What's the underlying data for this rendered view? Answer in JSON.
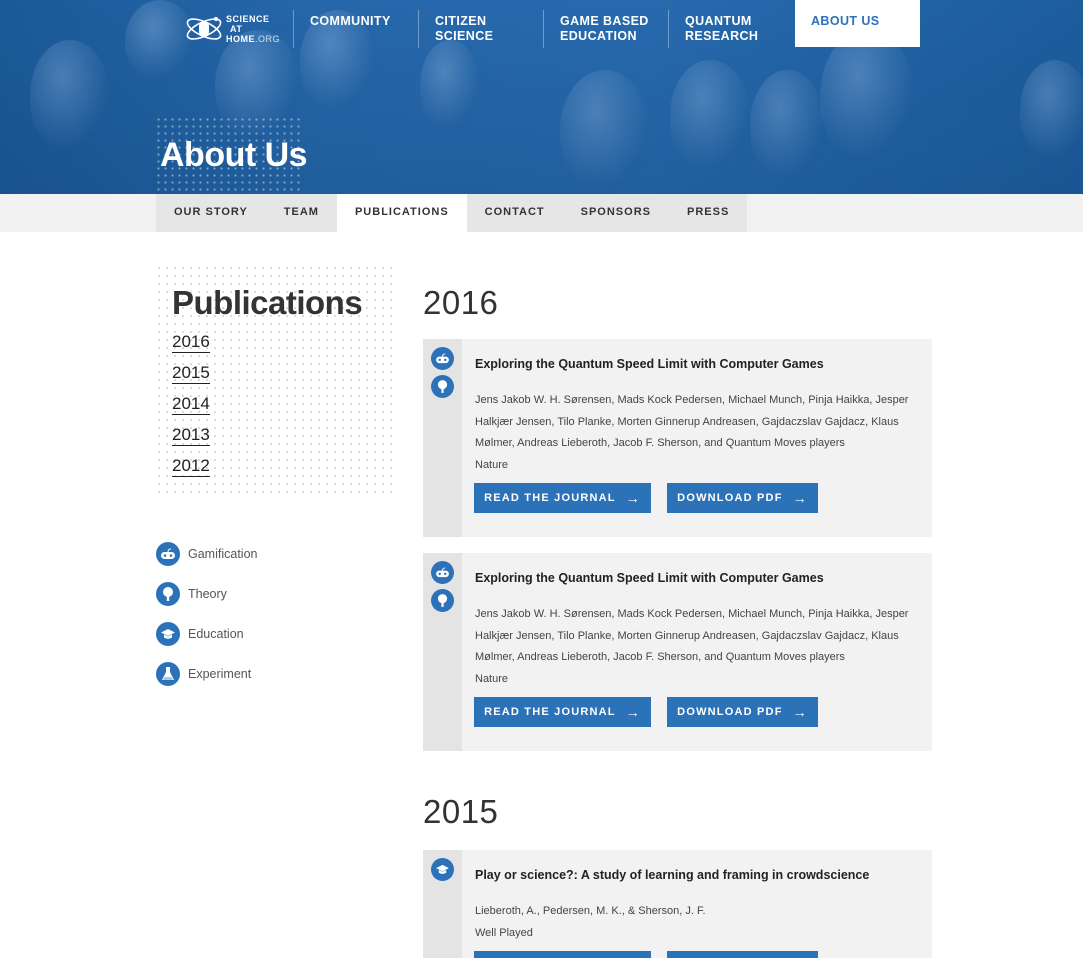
{
  "logo": {
    "line1": "SCIENCE",
    "line2": "AT",
    "line3": "HOME",
    "line3_suffix": ".ORG"
  },
  "nav": {
    "items": [
      {
        "label": "COMMUNITY"
      },
      {
        "label": "CITIZEN\nSCIENCE"
      },
      {
        "label": "GAME BASED\nEDUCATION"
      },
      {
        "label": "QUANTUM\nRESEARCH"
      }
    ],
    "active_label": "ABOUT US"
  },
  "hero": {
    "title": "About Us"
  },
  "subnav": {
    "items": [
      "OUR STORY",
      "TEAM",
      "PUBLICATIONS",
      "CONTACT",
      "SPONSORS",
      "PRESS"
    ],
    "active": "PUBLICATIONS"
  },
  "sidebar": {
    "title": "Publications",
    "years": [
      "2016",
      "2015",
      "2014",
      "2013",
      "2012"
    ],
    "legend": [
      {
        "label": "Gamification",
        "icon": "gamepad-icon"
      },
      {
        "label": "Theory",
        "icon": "lightbulb-icon"
      },
      {
        "label": "Education",
        "icon": "graduation-cap-icon"
      },
      {
        "label": "Experiment",
        "icon": "flask-icon"
      }
    ]
  },
  "sections": [
    {
      "year": "2016",
      "cards": [
        {
          "title": "Exploring the Quantum Speed Limit with Computer Games",
          "authors": "Jens Jakob W. H. Sørensen, Mads Kock Pedersen, Michael Munch, Pinja Haikka, Jesper Halkjær Jensen, Tilo Planke, Morten Ginnerup Andreasen, Gajdaczslav Gajdacz, Klaus Mølmer, Andreas Lieberoth, Jacob F. Sherson, and Quantum Moves players",
          "journal": "Nature",
          "icons": [
            "gamepad-icon",
            "lightbulb-icon"
          ]
        },
        {
          "title": "Exploring the Quantum Speed Limit with Computer Games",
          "authors": "Jens Jakob W. H. Sørensen, Mads Kock Pedersen, Michael Munch, Pinja Haikka, Jesper Halkjær Jensen, Tilo Planke, Morten Ginnerup Andreasen, Gajdaczslav Gajdacz, Klaus Mølmer, Andreas Lieberoth, Jacob F. Sherson, and Quantum Moves players",
          "journal": "Nature",
          "icons": [
            "gamepad-icon",
            "lightbulb-icon"
          ]
        }
      ]
    },
    {
      "year": "2015",
      "cards": [
        {
          "title": "Play or science?: A study of learning and framing in crowdscience",
          "authors": "Lieberoth, A., Pedersen, M. K., & Sherson, J. F.",
          "journal": "Well Played",
          "icons": [
            "graduation-cap-icon"
          ]
        }
      ]
    }
  ],
  "buttons": {
    "read": "READ THE JOURNAL",
    "download": "DOWNLOAD PDF",
    "arrow": "→"
  },
  "colors": {
    "accent": "#2b72b9",
    "hero": "#2a6fb5",
    "card_bg": "#f2f2f2"
  }
}
